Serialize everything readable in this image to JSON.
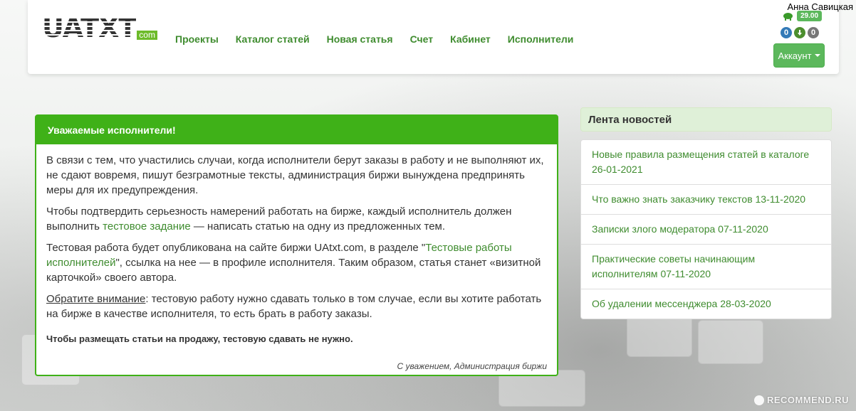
{
  "user": {
    "name": "Анна Савицкая",
    "balance": "29.00",
    "badge_blue": "0",
    "badge_gray": "0",
    "account_label": "Аккаунт"
  },
  "logo": {
    "main": "UATXT",
    "suffix": "com"
  },
  "nav": {
    "items": [
      {
        "label": "Проекты"
      },
      {
        "label": "Каталог статей"
      },
      {
        "label": "Новая статья"
      },
      {
        "label": "Счет"
      },
      {
        "label": "Кабинет"
      },
      {
        "label": "Исполнители"
      }
    ]
  },
  "notice": {
    "title": "Уважаемые исполнители!",
    "p1": "В связи с тем, что участились случаи, когда исполнители берут заказы в работу и не выполняют их, не сдают вовремя, пишут безграмотные тексты, администрация биржи вынуждена предпринять меры для их предупреждения.",
    "p2_before": "Чтобы подтвердить серьезность намерений работать на бирже, каждый исполнитель должен выполнить ",
    "p2_link": "тестовое задание",
    "p2_after": " — написать статью на одну из предложенных тем.",
    "p3_before": "Тестовая работа будет опубликована на сайте биржи UAtxt.com, в разделе \"",
    "p3_link": "Тестовые работы исполнителей",
    "p3_after": "\", ссылка на нее — в профиле исполнителя. Таким образом, статья станет «визитной карточкой» своего автора.",
    "p4_underlined": "Обратите внимание",
    "p4_after": ": тестовую работу нужно сдавать только в том случае, если вы хотите работать на бирже в качестве исполнителя, то есть брать в работу заказы.",
    "bold_note": "Чтобы размещать статьи на продажу, тестовую сдавать не нужно.",
    "signature": "С уважением, Администрация биржи"
  },
  "news": {
    "title": "Лента новостей",
    "items": [
      {
        "text": "Новые правила размещения статей в каталоге 26-01-2021"
      },
      {
        "text": "Что важно знать заказчику текстов 13-11-2020"
      },
      {
        "text": "Записки злого модератора 07-11-2020"
      },
      {
        "text": "Практические советы начинающим исполнителям 07-11-2020"
      },
      {
        "text": "Об удалении мессенджера 28-03-2020"
      }
    ]
  },
  "watermark": "RECOMMEND.RU",
  "colors": {
    "accent_green": "#3fb118",
    "link_green": "#3f8c2f",
    "button_green": "#5cb85c"
  }
}
